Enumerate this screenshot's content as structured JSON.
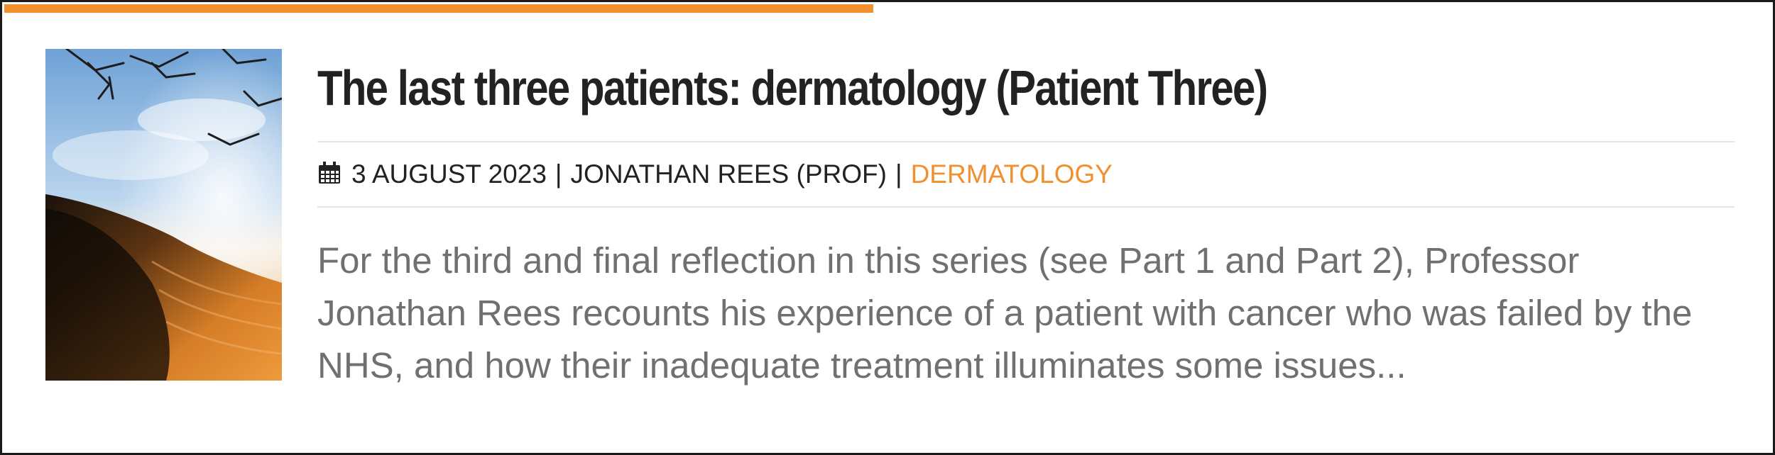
{
  "post": {
    "title": "The last three patients: dermatology (Patient Three)",
    "date": "3 AUGUST 2023",
    "author": "JONATHAN REES (PROF)",
    "separator": "|",
    "category": "DERMATOLOGY",
    "excerpt": "For the third and final reflection in this series (see Part 1 and Part 2), Professor Jonathan Rees recounts his experience of a patient with cancer who was failed by the NHS, and how their inadequate treatment illuminates some issues..."
  },
  "colors": {
    "accent": "#f0902f",
    "title": "#222222",
    "excerpt": "#707070",
    "border": "#1a1a1a"
  },
  "icons": {
    "date": "calendar-icon"
  }
}
